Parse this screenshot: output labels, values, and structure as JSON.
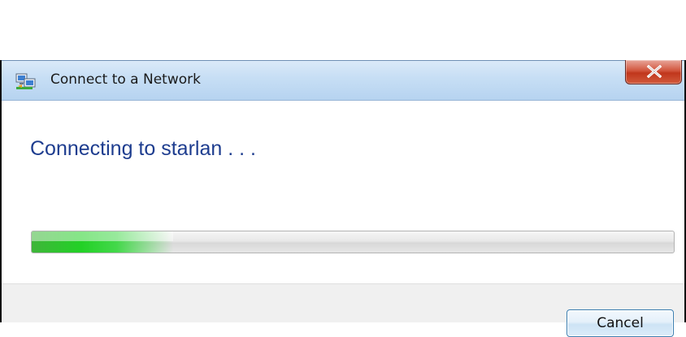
{
  "window": {
    "title": "Connect to a Network",
    "icon": "network-connection-icon",
    "close_icon": "close-x-icon"
  },
  "content": {
    "heading": "Connecting to starlan . . .",
    "progress": {
      "percent": 22,
      "indeterminate": true,
      "fill_color": "#22d126"
    }
  },
  "footer": {
    "cancel_label": "Cancel"
  },
  "colors": {
    "heading_text": "#1e3d8f",
    "titlebar": "#c8dff5",
    "close_button": "#c0361c",
    "footer_background": "#f0f0f0"
  }
}
